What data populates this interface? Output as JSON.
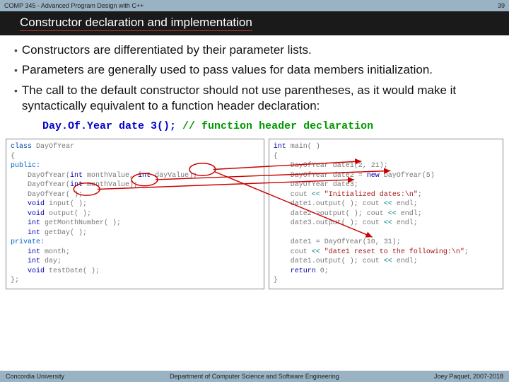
{
  "topbar": {
    "course": "COMP 345 - Advanced Program Design with C++",
    "page": "39"
  },
  "title": "Constructor declaration and implementation",
  "bullets": [
    "Constructors are differentiated by their parameter lists.",
    "Parameters are generally used to pass values for data members initialization.",
    "The call to the default constructor should not use parentheses, as it would make it syntactically equivalent to a function header declaration:"
  ],
  "code_inline": {
    "stmt": "Day.Of.Year  date 3();",
    "comment": "// function header declaration"
  },
  "left_code": {
    "l1a": "class",
    "l1b": " DayOfYear",
    "l2": "{",
    "l3": "public:",
    "l4a": "    DayOfYear(",
    "l4b": "int",
    "l4c": " monthValue, ",
    "l4d": "int",
    "l4e": " dayValue);",
    "l5a": "    DayOfYear(",
    "l5b": "int",
    "l5c": " monthValue);",
    "l6": "    DayOfYear( );",
    "l7a": "    ",
    "l7b": "void",
    "l7c": " input( );",
    "l8a": "    ",
    "l8b": "void",
    "l8c": " output( );",
    "l9a": "    ",
    "l9b": "int",
    "l9c": " getMonthNumber( );",
    "l10a": "    ",
    "l10b": "int",
    "l10c": " getDay( );",
    "l11": "private:",
    "l12a": "    ",
    "l12b": "int",
    "l12c": " month;",
    "l13a": "    ",
    "l13b": "int",
    "l13c": " day;",
    "l14a": "    ",
    "l14b": "void",
    "l14c": " testDate( );",
    "l15": "};"
  },
  "right_code": {
    "r1a": "int",
    "r1b": " main( )",
    "r2": "{",
    "r3": "    DayOfYear date1(2, 21);",
    "r4a": "    DayOfYear date2 = ",
    "r4b": "new",
    "r4c": " DayOfYear(5)",
    "r5": "    DayOfYear date3;",
    "r6a": "    cout ",
    "r6b": "<<",
    "r6c": " ",
    "r6d": "\"Initialized dates:\\n\"",
    "r6e": ";",
    "r7a": "    date1.output( ); cout ",
    "r7b": "<<",
    "r7c": " endl;",
    "r8a": "    date2->output( ); cout ",
    "r8b": "<<",
    "r8c": " endl;",
    "r9a": "    date3.output( ); cout ",
    "r9b": "<<",
    "r9c": " endl;",
    "blank": "",
    "r10": "    date1 = DayOfYear(10, 31);",
    "r11a": "    cout ",
    "r11b": "<<",
    "r11c": " ",
    "r11d": "\"date1 reset to the following:\\n\"",
    "r11e": ";",
    "r12a": "    date1.output( ); cout ",
    "r12b": "<<",
    "r12c": " endl;",
    "r13a": "    ",
    "r13b": "return",
    "r13c": " 0;",
    "r14": "}"
  },
  "footer": {
    "left": "Concordia University",
    "mid": "Department of Computer Science and Software Engineering",
    "right": "Joey Paquet, 2007-2018"
  }
}
